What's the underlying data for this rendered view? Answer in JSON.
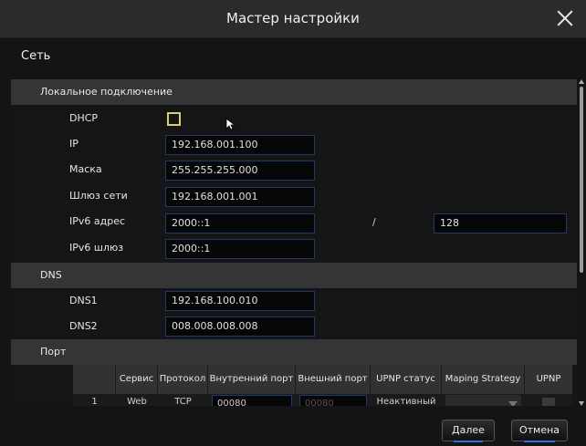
{
  "window": {
    "title": "Мастер настройки"
  },
  "page": {
    "title": "Сеть"
  },
  "local_connection": {
    "header": "Локальное подключение",
    "dhcp": {
      "label": "DHCP",
      "checked": false
    },
    "ip": {
      "label": "IP",
      "value": "192.168.001.100"
    },
    "mask": {
      "label": "Маска",
      "value": "255.255.255.000"
    },
    "gateway": {
      "label": "Шлюз сети",
      "value": "192.168.001.001"
    },
    "ipv6_address": {
      "label": "IPv6 адрес",
      "value": "2000::1",
      "separator": "/",
      "prefix": "128"
    },
    "ipv6_gateway": {
      "label": "IPv6 шлюз",
      "value": "2000::1"
    }
  },
  "dns": {
    "header": "DNS",
    "dns1": {
      "label": "DNS1",
      "value": "192.168.100.010"
    },
    "dns2": {
      "label": "DNS2",
      "value": "008.008.008.008"
    }
  },
  "port": {
    "header": "Порт",
    "columns": [
      "",
      "Сервис",
      "Протокол",
      "Внутренний порт",
      "Внешний порт",
      "UPNP статус",
      "Maping Strategy",
      "UPNP"
    ],
    "rows": [
      {
        "index": "1",
        "service": "Web",
        "protocol": "TCP",
        "internal_port": "00080",
        "external_port": "00080",
        "upnp_status": "Неактивный",
        "mapping_strategy": ""
      }
    ]
  },
  "footer": {
    "next_label": "Далее",
    "cancel_label": "Отмена"
  },
  "colors": {
    "accent": "#2f6fd8",
    "input_border": "#1e3a6a",
    "checkbox_border": "#d8d070"
  },
  "icons": {
    "close": "close-icon",
    "cursor": "mouse-pointer-icon",
    "scroll_up": "scroll-up-icon",
    "scroll_down": "scroll-down-icon",
    "dropdown": "chevron-down-icon"
  }
}
